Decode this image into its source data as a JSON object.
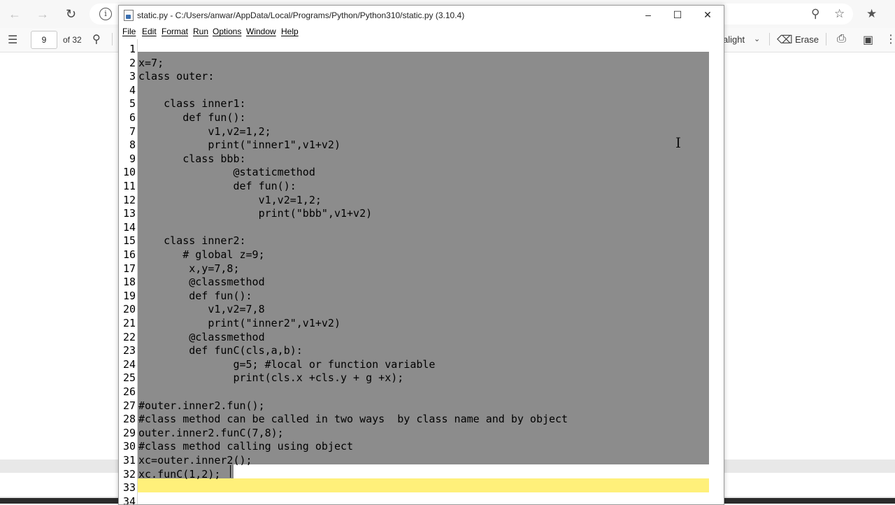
{
  "browser": {
    "page_number": "9",
    "page_total": "of 32",
    "highlight_label": "alight",
    "erase_label": "Erase"
  },
  "window": {
    "title": "static.py - C:/Users/anwar/AppData/Local/Programs/Python/Python310/static.py (3.10.4)",
    "menu": [
      "File",
      "Edit",
      "Format",
      "Run",
      "Options",
      "Window",
      "Help"
    ]
  },
  "editor": {
    "lines": [
      {
        "n": "1",
        "code": ""
      },
      {
        "n": "2",
        "code": "x=7;"
      },
      {
        "n": "3",
        "code": "class outer:"
      },
      {
        "n": "4",
        "code": ""
      },
      {
        "n": "5",
        "code": "    class inner1:"
      },
      {
        "n": "6",
        "code": "       def fun():"
      },
      {
        "n": "7",
        "code": "           v1,v2=1,2;"
      },
      {
        "n": "8",
        "code": "           print(\"inner1\",v1+v2)"
      },
      {
        "n": "9",
        "code": "       class bbb:"
      },
      {
        "n": "10",
        "code": "               @staticmethod"
      },
      {
        "n": "11",
        "code": "               def fun():"
      },
      {
        "n": "12",
        "code": "                   v1,v2=1,2;"
      },
      {
        "n": "13",
        "code": "                   print(\"bbb\",v1+v2)"
      },
      {
        "n": "14",
        "code": ""
      },
      {
        "n": "15",
        "code": "    class inner2:"
      },
      {
        "n": "16",
        "code": "       # global z=9;"
      },
      {
        "n": "17",
        "code": "        x,y=7,8;"
      },
      {
        "n": "18",
        "code": "        @classmethod"
      },
      {
        "n": "19",
        "code": "        def fun():"
      },
      {
        "n": "20",
        "code": "           v1,v2=7,8"
      },
      {
        "n": "21",
        "code": "           print(\"inner2\",v1+v2)"
      },
      {
        "n": "22",
        "code": "        @classmethod"
      },
      {
        "n": "23",
        "code": "        def funC(cls,a,b):"
      },
      {
        "n": "24",
        "code": "               g=5; #local or function variable"
      },
      {
        "n": "25",
        "code": "               print(cls.x +cls.y + g +x);"
      },
      {
        "n": "26",
        "code": ""
      },
      {
        "n": "27",
        "code": "#outer.inner2.fun();"
      },
      {
        "n": "28",
        "code": "#class method can be called in two ways  by class name and by object"
      },
      {
        "n": "29",
        "code": "outer.inner2.funC(7,8);"
      },
      {
        "n": "30",
        "code": "#class method calling using object"
      },
      {
        "n": "31",
        "code": "xc=outer.inner2();"
      },
      {
        "n": "32",
        "code": "xc.funC(1,2);"
      },
      {
        "n": "33",
        "code": ""
      },
      {
        "n": "34",
        "code": ""
      }
    ]
  }
}
